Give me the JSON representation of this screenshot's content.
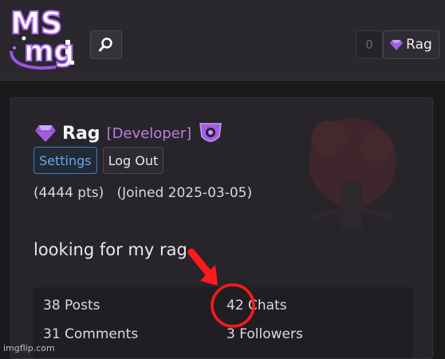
{
  "colors": {
    "accent_purple": "#a05fe0",
    "settings_blue": "#3f7cc7",
    "annotation_red": "#ff1a1a"
  },
  "header": {
    "logo_text_line1": "MS",
    "logo_text_line2": "mg:",
    "search_icon": "search-icon",
    "notification_count": "0",
    "user_button_label": "Rag",
    "user_button_icon": "gem-icon"
  },
  "profile": {
    "username": "Rag",
    "role": "[Developer]",
    "badge_icon": "badge-icon",
    "settings_label": "Settings",
    "logout_label": "Log Out",
    "points": "(4444 pts)",
    "joined": "(Joined 2025-03-05)",
    "bio": "looking for my rag",
    "stats": {
      "posts": "38 Posts",
      "chats": "42 Chats",
      "comments": "31 Comments",
      "followers": "3 Followers"
    }
  },
  "watermark_text": "imgflip.com"
}
